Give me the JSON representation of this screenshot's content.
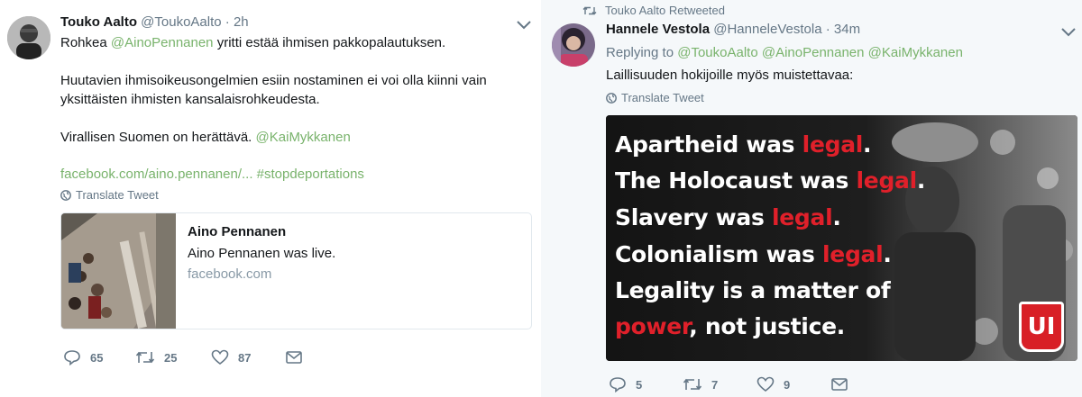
{
  "left": {
    "name": "Touko Aalto",
    "handle": "@ToukoAalto",
    "dot": "·",
    "time": "2h",
    "text1_prefix": "Rohkea ",
    "text1_mention": "@AinoPennanen",
    "text1_suffix": " yritti estää ihmisen pakkopalautuksen.",
    "text2_line1": "Huutavien ihmisoikeusongelmien esiin nostaminen ei voi olla kiinni vain",
    "text2_line2": "yksittäisten ihmisten kansalaisrohkeudesta.",
    "text3_prefix": "Virallisen Suomen on herättävä. ",
    "text3_mention": "@KaiMykkanen",
    "link_fb": "facebook.com/aino.pennanen/...",
    "link_hashtag": "#stopdeportations",
    "translate": "Translate Tweet",
    "card": {
      "title": "Aino Pennanen",
      "description": "Aino Pennanen was live.",
      "domain": "facebook.com"
    },
    "actions": {
      "replies": "65",
      "retweets": "25",
      "likes": "87"
    }
  },
  "right": {
    "retweeted_by": "Touko Aalto Retweeted",
    "name": "Hannele Vestola",
    "handle": "@HanneleVestola",
    "dot": "·",
    "time": "34m",
    "replying_label": "Replying to",
    "replying_to": [
      "@ToukoAalto",
      "@AinoPennanen",
      "@KaiMykkanen"
    ],
    "text": "Laillisuuden hokijoille myös muistettavaa:",
    "translate": "Translate Tweet",
    "image_lines": [
      {
        "pre": "Apartheid was ",
        "red": "legal",
        "post": "."
      },
      {
        "pre": "The Holocaust was ",
        "red": "legal",
        "post": "."
      },
      {
        "pre": "Slavery was ",
        "red": "legal",
        "post": "."
      },
      {
        "pre": "Colonialism was ",
        "red": "legal",
        "post": "."
      },
      {
        "pre": "Legality is a matter of",
        "red": "",
        "post": ""
      },
      {
        "pre": "",
        "red": "power",
        "post": ", not justice."
      }
    ],
    "image_logo": "UI",
    "actions": {
      "replies": "5",
      "retweets": "7",
      "likes": "9"
    }
  },
  "colors": {
    "link": "#79b36c",
    "secondary": "#657786",
    "logo_red": "#d81f26"
  }
}
